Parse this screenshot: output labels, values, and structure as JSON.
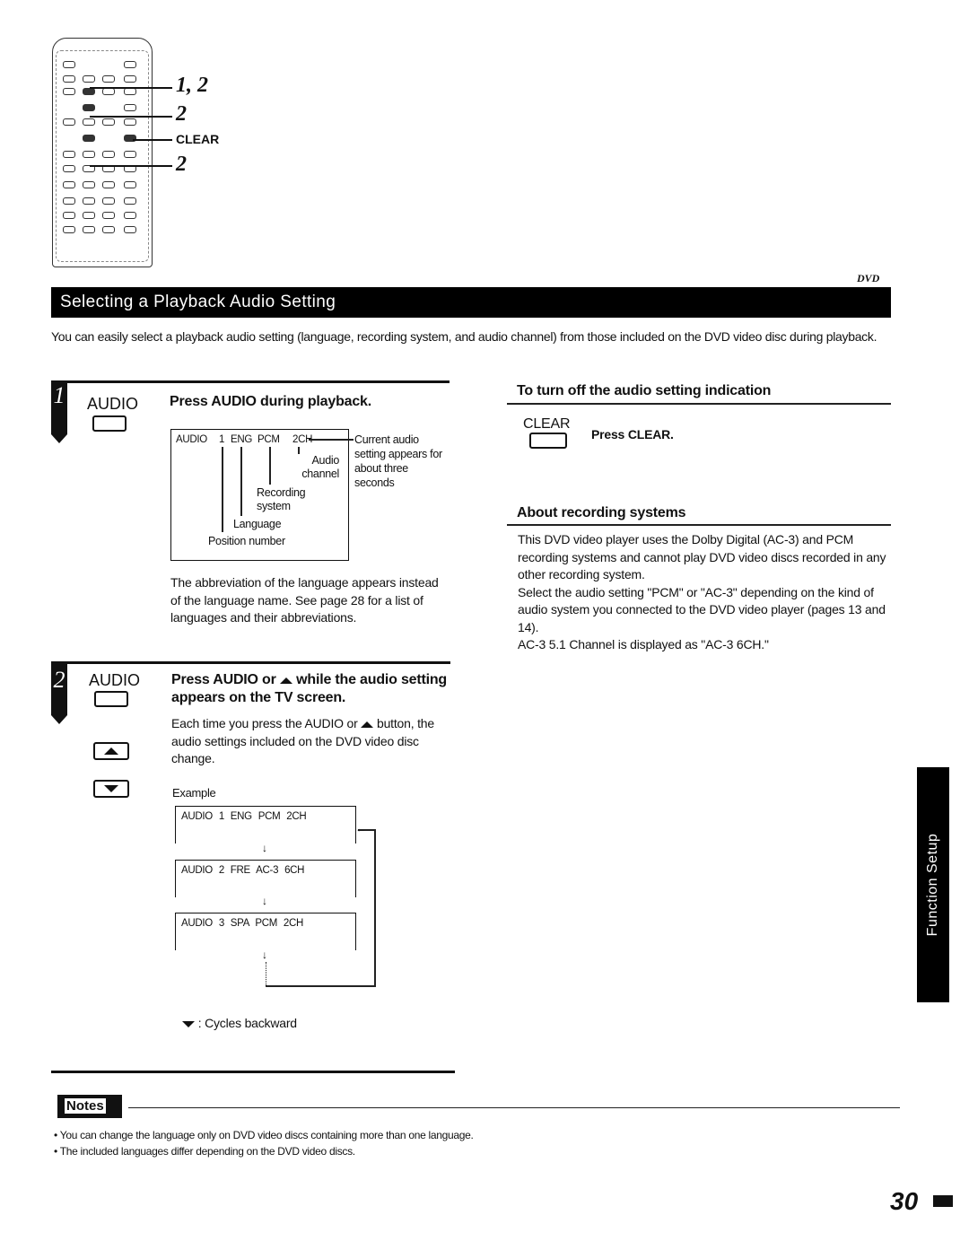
{
  "remote": {
    "callouts": [
      "1, 2",
      "2",
      "CLEAR",
      "2"
    ]
  },
  "header": {
    "title": "Selecting a Playback Audio Setting",
    "badge": "DVD"
  },
  "intro": "You can easily select a playback audio setting (language, recording system, and audio channel) from those included on the DVD video disc during playback.",
  "step1": {
    "number": "1",
    "key_label": "AUDIO",
    "heading": "Press AUDIO during playback.",
    "diagram": {
      "display": [
        "AUDIO",
        "1",
        "ENG",
        "PCM",
        "2CH"
      ],
      "labels": {
        "current": "Current audio setting appears for about three seconds",
        "audio_channel": "Audio channel",
        "recording_system": "Recording system",
        "language": "Language",
        "position_number": "Position number"
      }
    },
    "body": "The abbreviation of the language appears instead of the language name. See page 28 for a list of languages and their abbreviations."
  },
  "step2": {
    "number": "2",
    "key_label": "AUDIO",
    "heading_part1": "Press AUDIO or",
    "heading_part2": "while the audio setting appears on the TV screen.",
    "body_part1": "Each time you press the AUDIO or",
    "body_part2": "button, the audio settings included on the DVD video disc change.",
    "example_label": "Example",
    "examples": [
      "AUDIO 1 ENG PCM 2CH",
      "AUDIO 2 FRE AC-3 6CH",
      "AUDIO 3 SPA PCM 2CH"
    ],
    "cycles_backward": ": Cycles backward"
  },
  "right": {
    "turn_off_heading": "To turn off the audio setting indication",
    "clear_key_label": "CLEAR",
    "press_clear": "Press CLEAR.",
    "about_heading": "About recording systems",
    "about_body": [
      "This DVD video player uses the Dolby Digital (AC-3) and PCM recording systems and cannot play DVD video discs recorded in any other recording system.",
      "Select the audio setting \"PCM\" or \"AC-3\" depending on the kind of audio system you connected to the DVD video player (pages 13 and 14).",
      "AC-3 5.1 Channel is displayed as \"AC-3 6CH.\""
    ]
  },
  "side_tab": "Function Setup",
  "notes": {
    "label": "Notes",
    "items": [
      "You can change the language only on DVD video discs containing more than one language.",
      "The included languages differ depending on the DVD video discs."
    ]
  },
  "page_number": "30"
}
